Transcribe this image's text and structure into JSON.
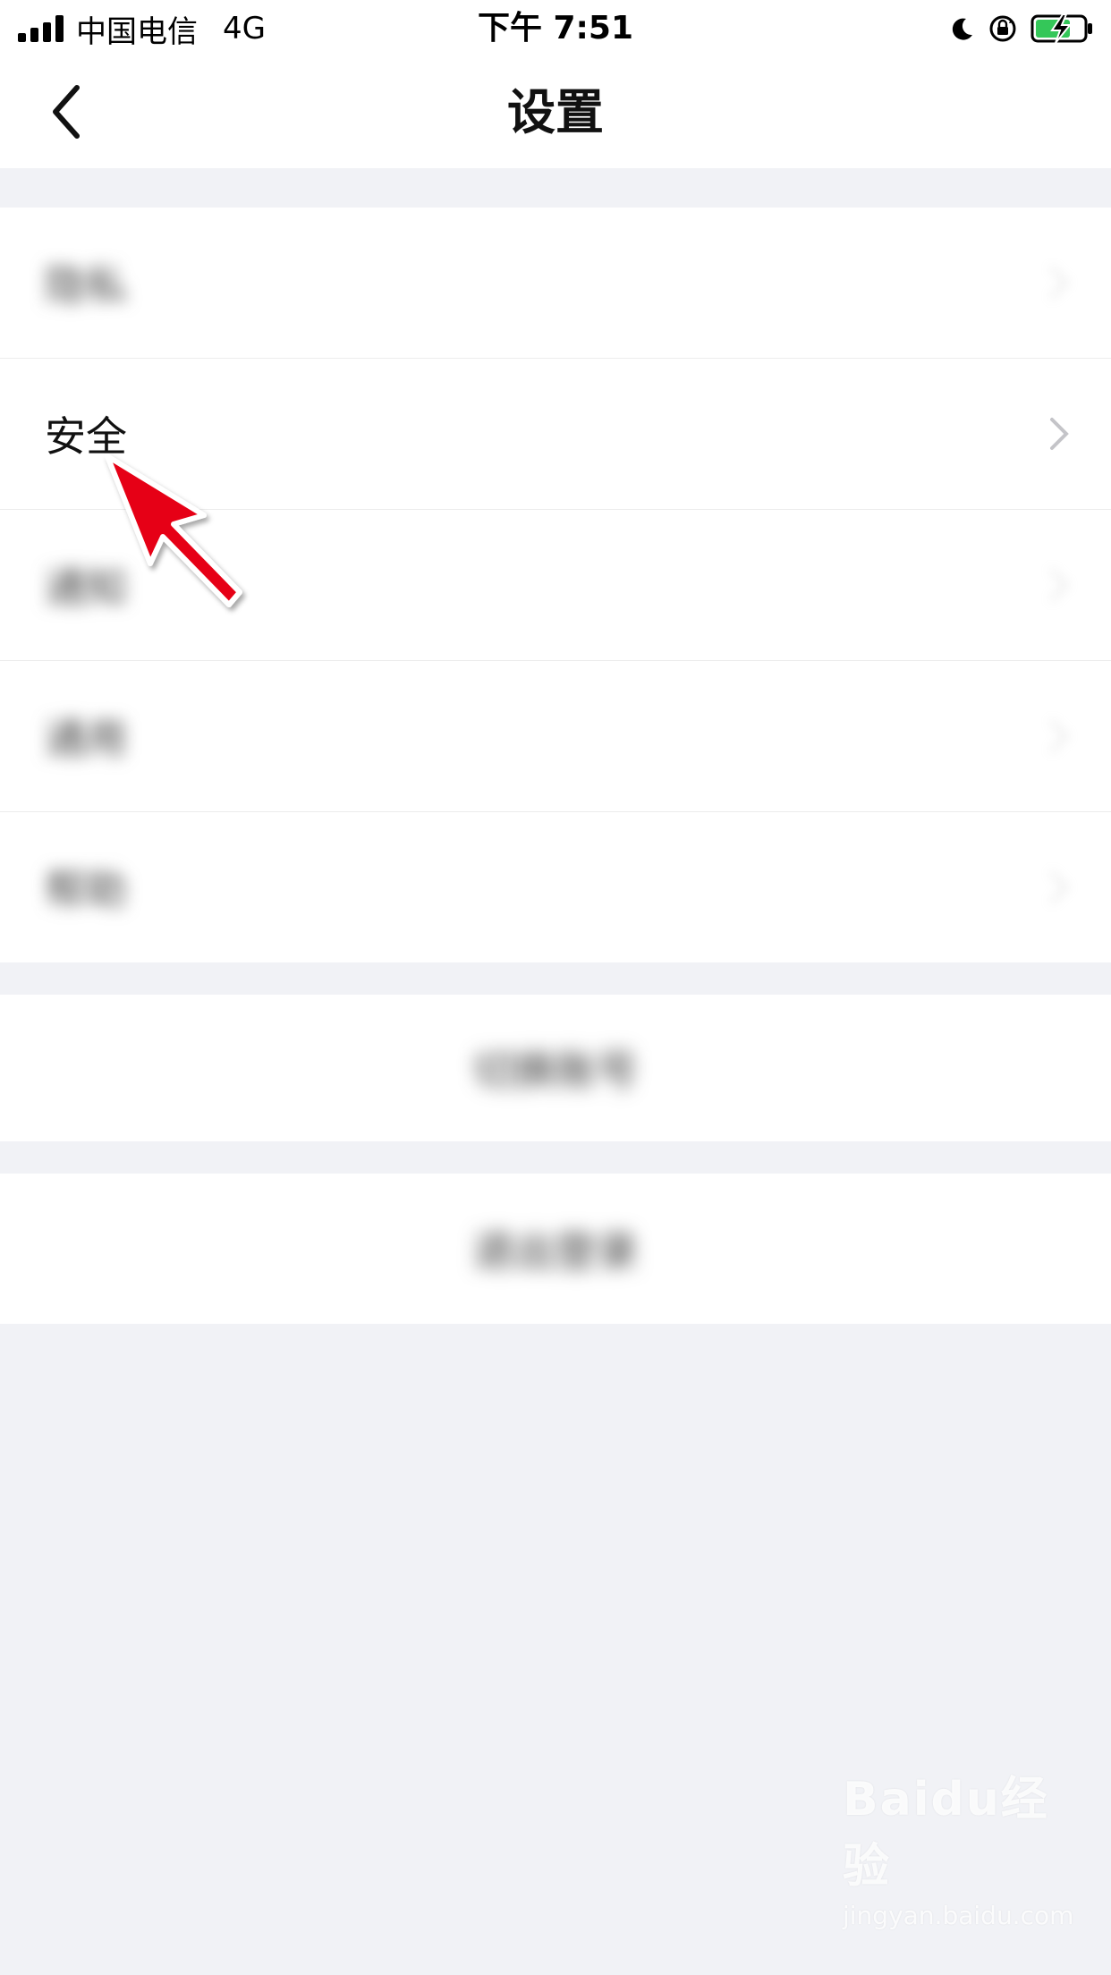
{
  "status_bar": {
    "carrier": "中国电信",
    "network": "4G",
    "time": "下午 7:51",
    "icons": [
      "signal-icon",
      "moon-icon",
      "rotation-lock-icon",
      "battery-charging-icon"
    ]
  },
  "nav": {
    "back_icon": "chevron-left-icon",
    "title": "设置"
  },
  "settings": {
    "items": [
      {
        "label": "隐私",
        "blurred": true
      },
      {
        "label": "安全",
        "blurred": false
      },
      {
        "label": "通知",
        "blurred": true
      },
      {
        "label": "通用",
        "blurred": true
      },
      {
        "label": "帮助",
        "blurred": true
      }
    ]
  },
  "actions": {
    "switch_account": "切换账号",
    "logout": "退出登录"
  },
  "annotation": {
    "arrow_color": "#e60012",
    "target": "安全"
  },
  "watermark": {
    "logo": "Baidu经验",
    "url": "jingyan.baidu.com"
  },
  "colors": {
    "background": "#f1f2f6",
    "card": "#ffffff",
    "battery": "#34c759"
  }
}
